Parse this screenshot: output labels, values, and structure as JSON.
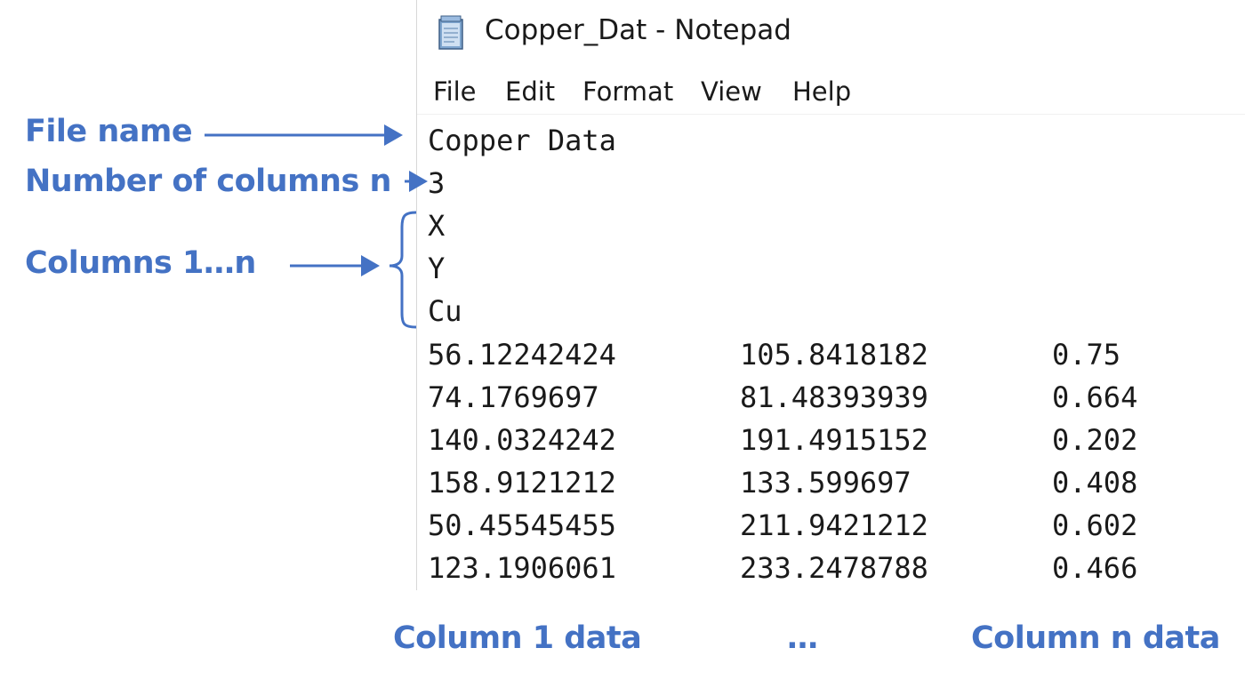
{
  "window": {
    "title": "Copper_Dat - Notepad",
    "icon": "notepad-icon"
  },
  "menu": {
    "items": [
      "File",
      "Edit",
      "Format",
      "View",
      "Help"
    ]
  },
  "file": {
    "name_line": "Copper Data",
    "column_count": "3",
    "columns": [
      "X",
      "Y",
      "Cu"
    ],
    "rows": [
      [
        "56.12242424",
        "105.8418182",
        "0.75"
      ],
      [
        "74.1769697",
        "81.48393939",
        "0.664"
      ],
      [
        "140.0324242",
        "191.4915152",
        "0.202"
      ],
      [
        "158.9121212",
        "133.599697",
        "0.408"
      ],
      [
        "50.45545455",
        "211.9421212",
        "0.602"
      ],
      [
        "123.1906061",
        "233.2478788",
        "0.466"
      ]
    ]
  },
  "annotations": {
    "file_name": "File name",
    "number_of_columns": "Number of columns n",
    "columns_range": "Columns 1…n",
    "column_1_data": "Column 1 data",
    "ellipsis": "…",
    "column_n_data": "Column n data"
  },
  "colors": {
    "annotation": "#4472c4",
    "text": "#1a1a1a",
    "background": "#ffffff"
  }
}
